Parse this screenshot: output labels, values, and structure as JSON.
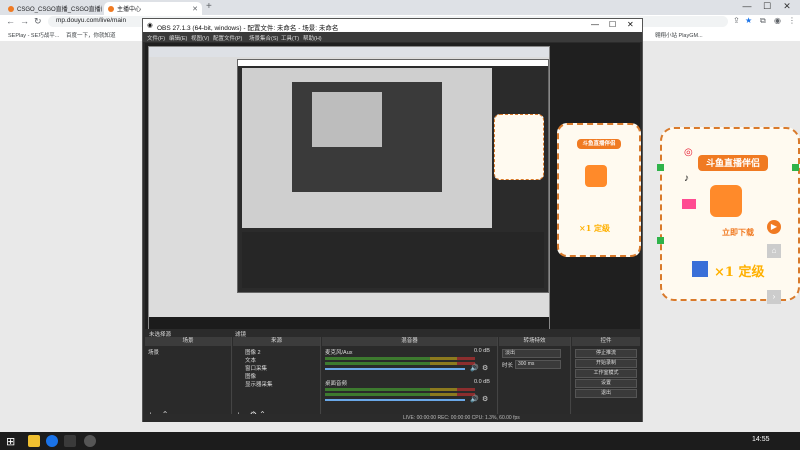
{
  "browser": {
    "tabs": [
      {
        "title": "CSGO_CSGO直播_CSGO直播间"
      },
      {
        "title": "主播中心"
      }
    ],
    "new_tab": "+",
    "url": "mp.douyu.com/live/main",
    "bookmarks": [
      "SEPlay - SE巧战平...",
      "百度一下，你就知道",
      "翱翔小站 PlayGM..."
    ],
    "window_controls": [
      "—",
      "☐",
      "✕"
    ]
  },
  "obs": {
    "title": "OBS 27.1.3 (64-bit, windows) - 配置文件: 未命名 - 场景: 未命名",
    "menu": [
      "文件(F)",
      "编辑(E)",
      "视图(V)",
      "配置文件(P)",
      "场景集合(S)",
      "工具(T)",
      "帮助(H)"
    ],
    "panels": {
      "scenes": {
        "header": "场景",
        "items": [
          "场景"
        ]
      },
      "sources": {
        "header": "来源",
        "items": [
          "图像 2",
          "文本",
          "窗口采集",
          "图像",
          "显示器采集"
        ]
      },
      "mixer": {
        "header": "混音器",
        "tracks": [
          {
            "name": "麦克风/Aux",
            "db": "0.0 dB"
          },
          {
            "name": "桌面音频",
            "db": "0.0 dB"
          }
        ]
      },
      "transitions": {
        "header": "转场特效",
        "type": "淡出",
        "duration_label": "时长",
        "duration": "300 ms"
      },
      "controls": {
        "header": "控件",
        "buttons": [
          "停止推流",
          "开始录制",
          "工作室模式",
          "设置",
          "退出"
        ]
      }
    },
    "status": "LIVE: 00:00:00   REC: 00:00:00   CPU: 1.3%, 60.00 fps",
    "filter_tabs": [
      "未选择源",
      "滤镜"
    ]
  },
  "promo": {
    "title": "斗鱼直播伴侣",
    "download": "立即下载",
    "multiplier": "×1 定级"
  },
  "taskbar": {
    "time": "14:55"
  },
  "colors": {
    "accent": "#f07a22",
    "obs_bg": "#2b2b2b",
    "taskbar": "#1c1c1c"
  }
}
